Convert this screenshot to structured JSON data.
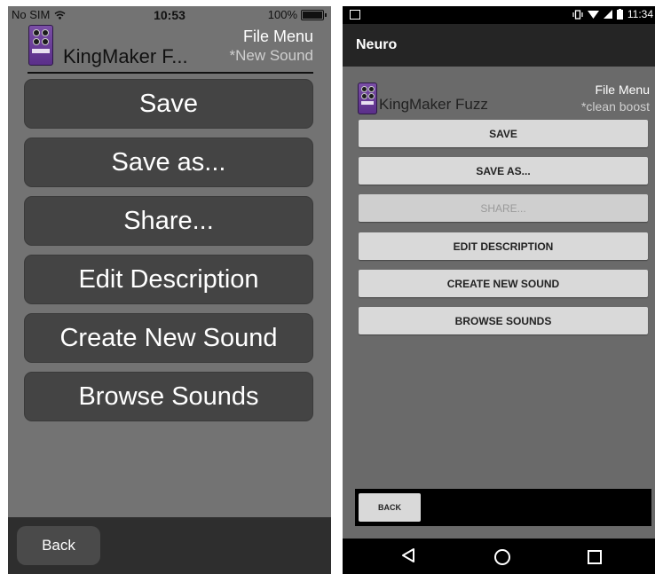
{
  "ios": {
    "status": {
      "carrier": "No SIM",
      "time": "10:53",
      "battery": "100%"
    },
    "header": {
      "sound_name": "KingMaker F...",
      "menu_title": "File Menu",
      "preset": "*New Sound"
    },
    "buttons": [
      "Save",
      "Save as...",
      "Share...",
      "Edit Description",
      "Create New Sound",
      "Browse Sounds"
    ],
    "back": "Back"
  },
  "android": {
    "status": {
      "time": "11:34"
    },
    "app_title": "Neuro",
    "header": {
      "sound_name": "KingMaker Fuzz",
      "menu_title": "File Menu",
      "preset": "*clean boost"
    },
    "buttons": [
      {
        "label": "SAVE",
        "enabled": true
      },
      {
        "label": "SAVE AS...",
        "enabled": true
      },
      {
        "label": "SHARE...",
        "enabled": false
      },
      {
        "label": "EDIT DESCRIPTION",
        "enabled": true
      },
      {
        "label": "CREATE NEW SOUND",
        "enabled": true
      },
      {
        "label": "BROWSE SOUNDS",
        "enabled": true
      }
    ],
    "back": "BACK"
  },
  "colors": {
    "pedal_purple": "#6b3d99",
    "ios_background": "#737373",
    "ios_button": "#444444",
    "android_button": "#d9d9d9"
  }
}
